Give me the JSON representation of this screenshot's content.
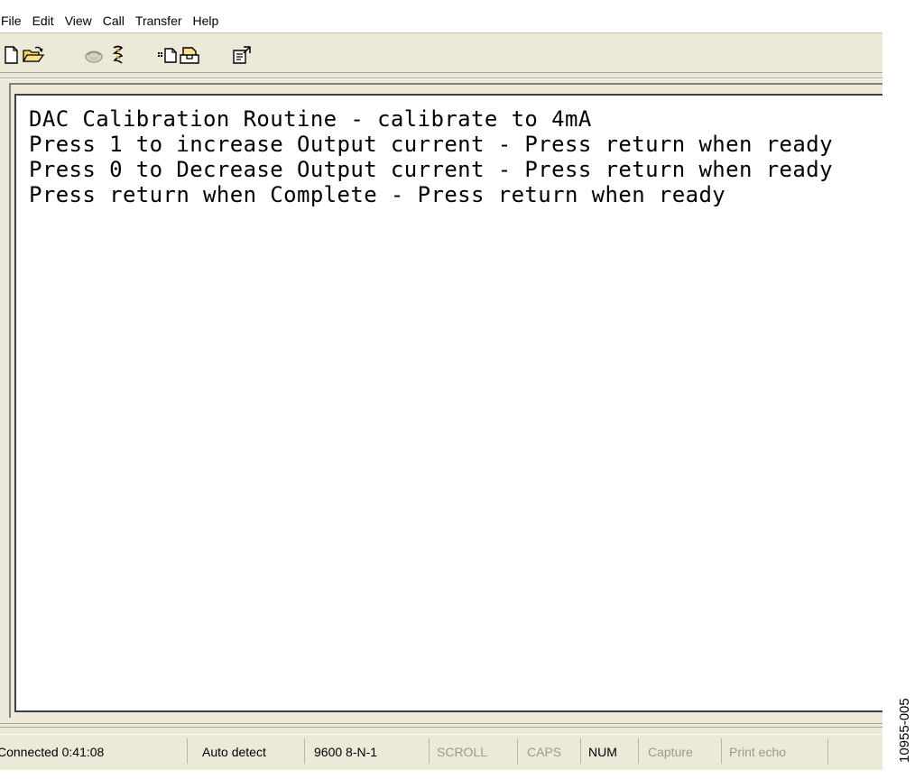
{
  "menu": {
    "items": [
      "File",
      "Edit",
      "View",
      "Call",
      "Transfer",
      "Help"
    ]
  },
  "toolbar": {
    "tools": [
      {
        "icon": "new-document-icon"
      },
      {
        "icon": "open-folder-icon"
      },
      {
        "icon": "phone-call-icon"
      },
      {
        "icon": "disconnect-icon"
      },
      {
        "icon": "send-file-icon"
      },
      {
        "icon": "receive-file-icon"
      },
      {
        "icon": "properties-icon"
      }
    ]
  },
  "terminal": {
    "lines": [
      "DAC Calibration Routine - calibrate to 4mA",
      "Press 1 to increase Output current - Press return when ready",
      "Press 0 to Decrease Output current - Press return when ready",
      "Press return when Complete - Press return when ready"
    ]
  },
  "status": {
    "connection": "Connected 0:41:08",
    "detect": "Auto detect",
    "port_settings": "9600 8-N-1",
    "scroll": "SCROLL",
    "caps": "CAPS",
    "num": "NUM",
    "capture": "Capture",
    "print_echo": "Print echo"
  },
  "figure_id": "10955-005",
  "colors": {
    "window_bg": "#ece9d8",
    "taskbar_blue": "#2f62c4",
    "dim_text": "#9c9a8e"
  }
}
